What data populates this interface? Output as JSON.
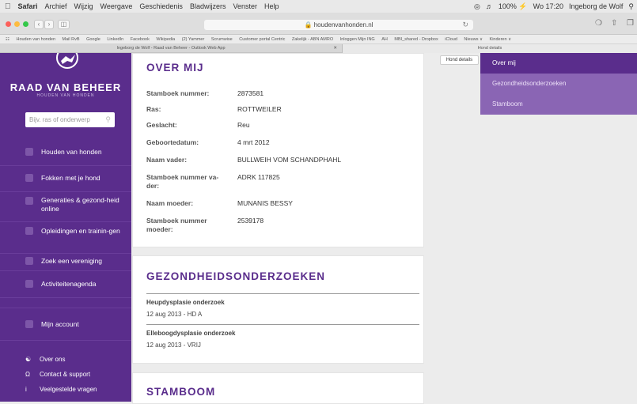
{
  "menubar": {
    "apple": "",
    "items": [
      "Safari",
      "Archief",
      "Wijzig",
      "Weergave",
      "Geschiedenis",
      "Bladwijzers",
      "Venster",
      "Help"
    ],
    "right": [
      "100% ⚡",
      "Wo 17:20",
      "Ingeborg de Wolf"
    ]
  },
  "toolbar": {
    "url": "houdenvanhonden.nl"
  },
  "favorites": [
    "Houden van honden",
    "Mail RvB",
    "Google",
    "LinkedIn",
    "Facebook",
    "Wikipedia",
    "(2) Yammer",
    "Scrumwise",
    "Customer portal Centric",
    "Zakelijk - ABN AMRO",
    "Inloggen Mijn ING",
    "AH",
    "MBI_shared - Dropbox",
    "iCloud",
    "Nieuws ∨",
    "Kinderen ∨"
  ],
  "tabs": {
    "tab1": "Ingeborg de Wolf - Raad van Beheer - Outlook Web App",
    "tab2": "Hond details"
  },
  "sidebar": {
    "brand": "RAAD VAN BEHEER",
    "brand_sub": "HOUDEN VAN HONDEN",
    "search_placeholder": "Bijv. ras of onderwerp",
    "nav": [
      "Houden van honden",
      "Fokken met je hond",
      "Generaties & gezond-heid online",
      "Opleidingen en trainin-gen",
      "Zoek een vereniging",
      "Activiteitenagenda",
      "Mijn account"
    ],
    "footer": [
      "Over ons",
      "Contact & support",
      "Veelgestelde vragen"
    ]
  },
  "over_mij": {
    "title": "OVER MIJ",
    "rows": [
      {
        "label": "Stamboek nummer:",
        "value": "2873581"
      },
      {
        "label": "Ras:",
        "value": "ROTTWEILER"
      },
      {
        "label": "Geslacht:",
        "value": "Reu"
      },
      {
        "label": "Geboortedatum:",
        "value": "4 mrt 2012"
      },
      {
        "label": "Naam vader:",
        "value": "BULLWEIH VOM SCHANDPHAHL"
      },
      {
        "label": "Stamboek nummer va-der:",
        "value": "ADRK 117825"
      },
      {
        "label": "Naam moeder:",
        "value": "MUNANIS BESSY"
      },
      {
        "label": "Stamboek nummer moeder:",
        "value": "2539178"
      }
    ]
  },
  "gezondheid": {
    "title": "GEZONDHEIDSONDERZOEKEN",
    "exams": [
      {
        "title": "Heupdysplasie onderzoek",
        "date": "12 aug 2013 - HD A"
      },
      {
        "title": "Elleboogdysplasie onderzoek",
        "date": "12 aug 2013 - VRIJ"
      }
    ]
  },
  "stamboom": {
    "title": "STAMBOOM"
  },
  "hond_details_button": "Hond details",
  "right_menu": [
    "Over mij",
    "Gezondheidsonderzoeken",
    "Stamboom"
  ]
}
